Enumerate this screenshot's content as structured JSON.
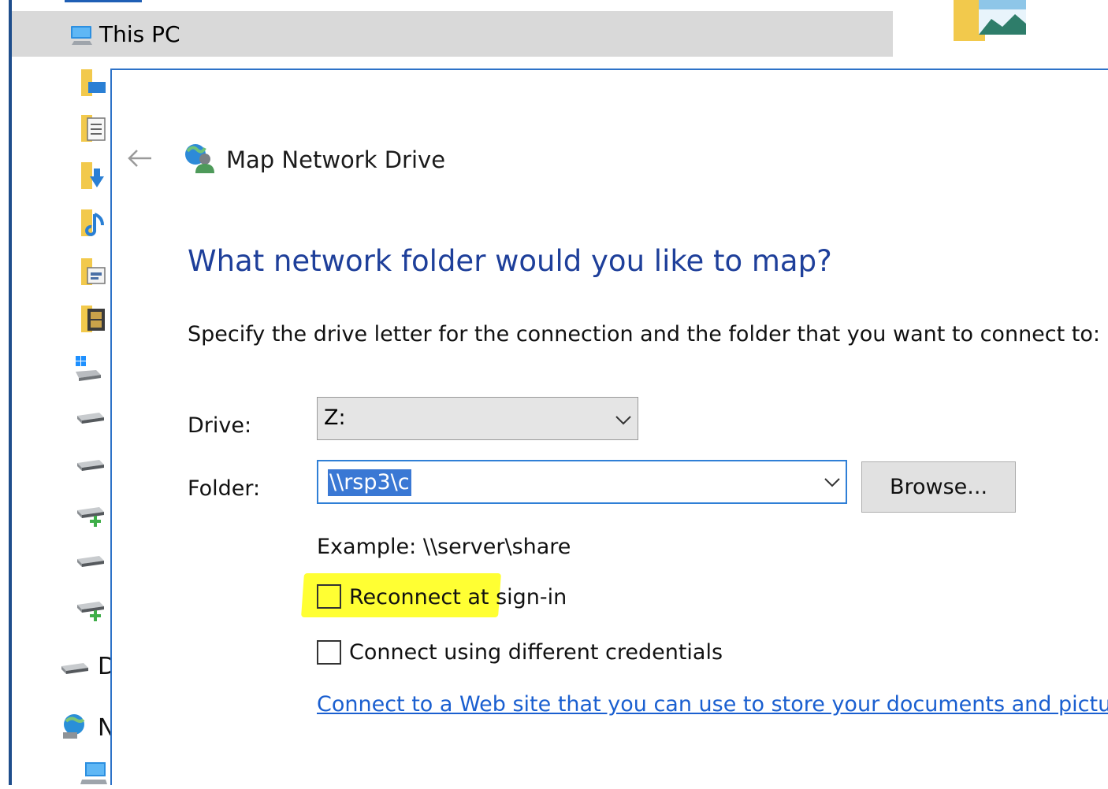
{
  "explorer": {
    "this_pc_label": "This PC",
    "partial_labels": [
      "D",
      "N"
    ],
    "nav_icons": [
      "desktop-folder-icon",
      "documents-folder-icon",
      "downloads-folder-icon",
      "music-folder-icon",
      "pictures-folder-icon",
      "videos-folder-icon",
      "windows-drive-icon",
      "drive-icon",
      "drive-icon",
      "network-drive-icon",
      "drive-icon",
      "network-drive-icon"
    ]
  },
  "dialog": {
    "title": "Map Network Drive",
    "heading": "What network folder would you like to map?",
    "instruction": "Specify the drive letter for the connection and the folder that you want to connect to:",
    "drive": {
      "label": "Drive:",
      "value": "Z:"
    },
    "folder": {
      "label": "Folder:",
      "value": "\\\\rsp3\\c"
    },
    "browse_label": "Browse...",
    "example": "Example: \\\\server\\share",
    "reconnect": {
      "label": "Reconnect at sign-in",
      "checked": false
    },
    "credentials": {
      "label": "Connect using different credentials",
      "checked": false
    },
    "web_link": "Connect to a Web site that you can use to store your documents and pictures"
  },
  "colors": {
    "heading": "#1e3f9a",
    "link": "#1a5fd0",
    "accent": "#2f7fd6",
    "highlight": "#ffff33",
    "selection": "#3a78d4"
  }
}
